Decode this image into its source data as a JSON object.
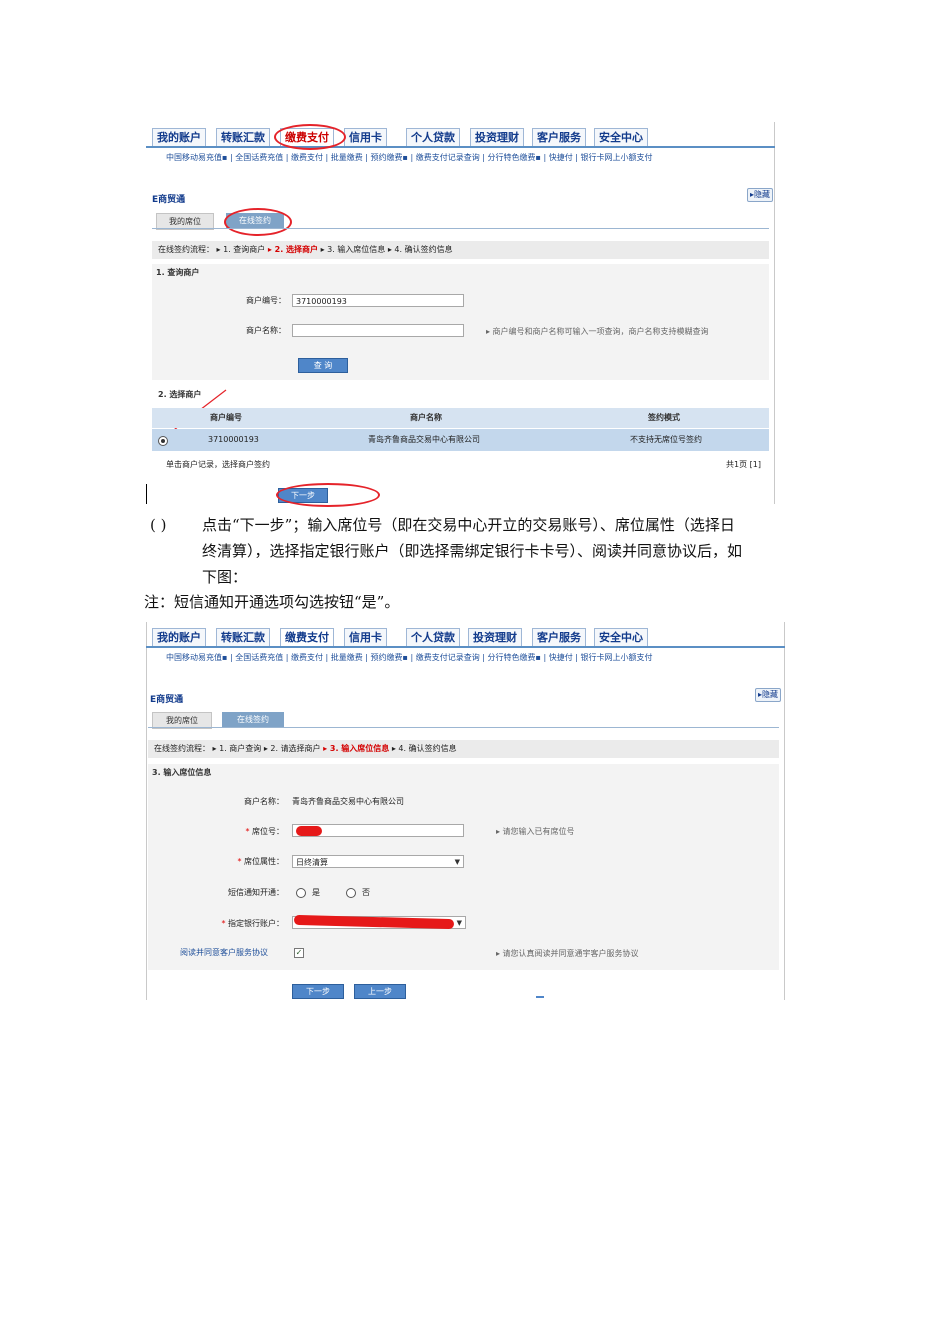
{
  "nav_tabs": [
    "我的账户",
    "转账汇款",
    "缴费支付",
    "信用卡",
    "个人贷款",
    "投资理财",
    "客户服务",
    "安全中心"
  ],
  "subnav_1": "中国移动易充值▪ | 全国话费充值 | 缴费支付 | 批量缴费 | 预约缴费▪ | 缴费支付记录查询 | 分行特色缴费▪ | 快捷付 | 银行卡网上小额支付",
  "subnav_2": "中国移动易充值▪ | 全国话费充值 | 缴费支付 | 批量缴费 | 预约缴费▪ | 缴费支付记录查询 | 分行特色缴费▪ | 快捷付 | 银行卡网上小额支付",
  "screen1": {
    "title": "E商贸通",
    "hide": "▸隐藏",
    "tab_mine": "我的席位",
    "tab_sign": "在线签约",
    "flow_label": "在线签约流程：",
    "flow_steps": [
      "▸ 1. 查询商户",
      "▸ 2. 选择商户",
      "▸ 3. 输入席位信息",
      "▸ 4. 确认签约信息"
    ],
    "sec1": "1. 查询商户",
    "merchant_no_label": "商户编号：",
    "merchant_no_value": "3710000193",
    "merchant_name_label": "商户名称：",
    "merchant_name_value": "",
    "query_hint": "▸ 商户编号和商户名称可输入一项查询，商户名称支持模糊查询",
    "query_btn": "查 询",
    "sec2": "2. 选择商户",
    "cols": [
      "商户编号",
      "商户名称",
      "签约模式"
    ],
    "row": [
      "3710000193",
      "青岛齐鲁商品交易中心有限公司",
      "不支持无席位号签约"
    ],
    "foot_left": "单击商户记录，选择商户签约",
    "foot_right": "共1页  [1]",
    "next_btn": "下一步"
  },
  "text": {
    "step_mark": "( )",
    "line1": "点击“下一步”；输入席位号（即在交易中心开立的交易账号）、席位属性（选择日",
    "line2": "终清算），选择指定银行账户（即选择需绑定银行卡卡号）、阅读并同意协议后，如",
    "line3": "下图：",
    "note": "注：短信通知开通选项勾选按钮“是”。"
  },
  "screen2": {
    "title": "E商贸通",
    "hide": "▸隐藏",
    "tab_mine": "我的席位",
    "tab_sign": "在线签约",
    "flow_label": "在线签约流程：",
    "flow_steps": [
      "▸ 1. 商户查询",
      "▸ 2. 请选择商户",
      "▸ 3. 输入席位信息",
      "▸ 4. 确认签约信息"
    ],
    "sec3": "3. 输入席位信息",
    "name_label": "商户名称：",
    "name_value": "青岛齐鲁商品交易中心有限公司",
    "seat_label": "席位号：",
    "seat_hint": "▸ 请您输入已有席位号",
    "attr_label": "席位属性：",
    "attr_value": "日终清算",
    "sms_label": "短信通知开通：",
    "sms_yes": "是",
    "sms_no": "否",
    "bank_label": "指定银行账户：",
    "agree_label": "阅读并同意客户服务协议",
    "agree_hint": "▸ 请您认真阅读并同意通宇客户服务协议",
    "next_btn": "下一步",
    "prev_btn": "上一步",
    "required_mark": "*"
  },
  "colors": {
    "accent_red": "#e5232a",
    "nav_blue": "#123b8c",
    "button_blue": "#4f86c9"
  }
}
